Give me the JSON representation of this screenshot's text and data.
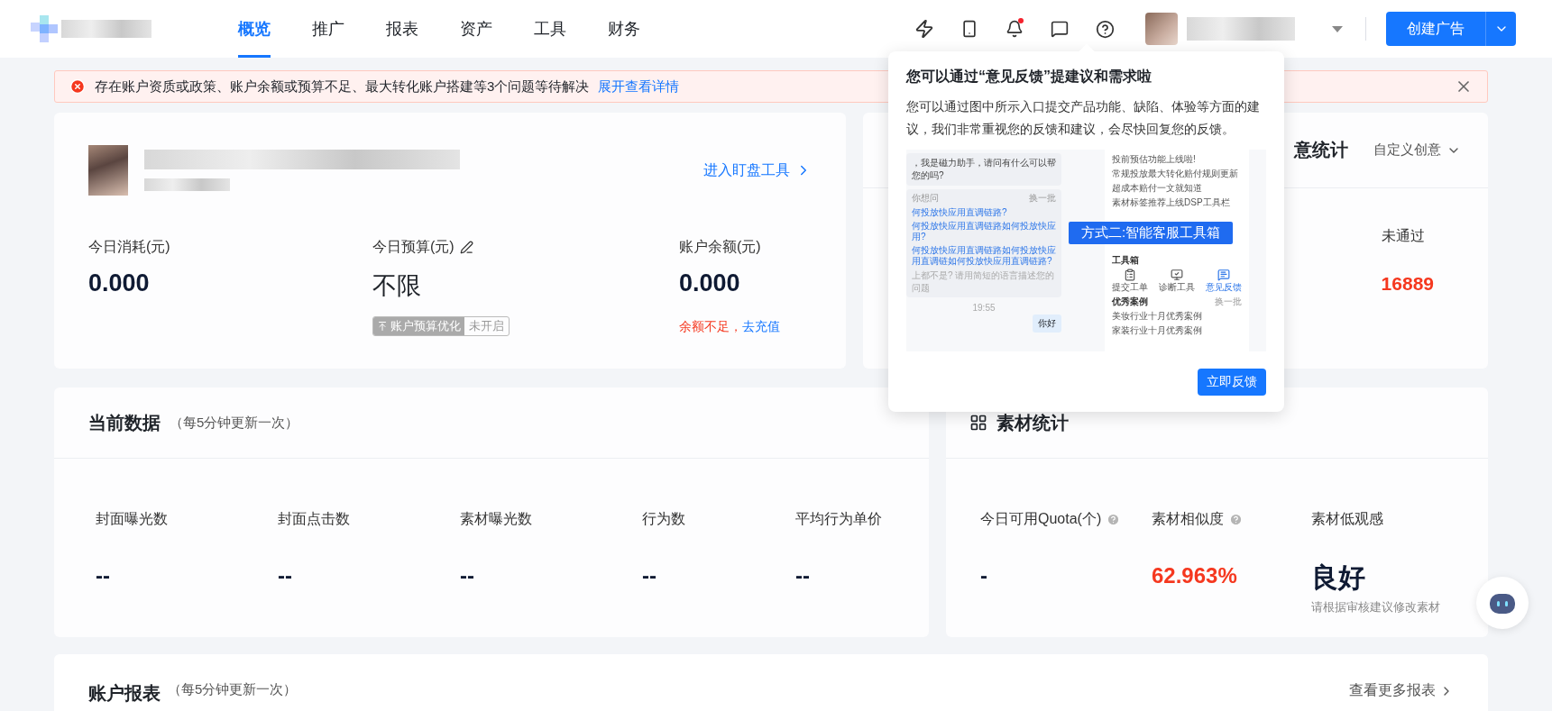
{
  "nav": {
    "tabs": [
      {
        "label": "概览",
        "selected": true
      },
      {
        "label": "推广",
        "selected": false
      },
      {
        "label": "报表",
        "selected": false
      },
      {
        "label": "资产",
        "selected": false
      },
      {
        "label": "工具",
        "selected": false
      },
      {
        "label": "财务",
        "selected": false
      }
    ],
    "notifications": {
      "unread": true
    },
    "create_button": {
      "label": "创建广告"
    }
  },
  "alert": {
    "message": "存在账户资质或政策、账户余额或预算不足、最大转化账户搭建等3个问题等待解决",
    "link": "展开查看详情"
  },
  "account_card": {
    "link": "进入盯盘工具",
    "stats": [
      {
        "kind": "plain",
        "label": "今日消耗(元)",
        "value": "0.000"
      },
      {
        "kind": "budget",
        "label": "今日预算(元)",
        "value": "不限",
        "tag": "账户预算优化",
        "tag_status": "未开启"
      },
      {
        "kind": "balance",
        "label": "账户余额(元)",
        "value": "0.000",
        "warning": "余额不足，",
        "action": "去充值"
      }
    ]
  },
  "creative_card": {
    "title": "意统计",
    "filter": "自定义创意",
    "stats": [
      {
        "label": "未通过",
        "value": "16889",
        "color": "#f5381f"
      }
    ]
  },
  "popover": {
    "title": "您可以通过“意见反馈”提建议和需求啦",
    "body": "您可以通过图中所示入口提交产品功能、缺陷、体验等方面的建议，我们非常重视您的反馈和建议，会尽快回复您的反馈。",
    "button": "立即反馈",
    "image": {
      "greeting": "，我是磁力助手，请问有什么可以帮您的吗?",
      "suggest_title": "你想问",
      "refresh": "换一批",
      "questions": [
        "何投放快应用直调链路?",
        "何投放快应用直调链路如何投放快应用?",
        "何投放快应用直调链路如何投放快应用直调链如何投放快应用直调链路?"
      ],
      "fallback": "上都不是? 请用简短的语言描述您的问题",
      "time": "19:55",
      "user_msg": "你好",
      "notices": [
        "投前预估功能上线啦!",
        "常规投放最大转化赔付规则更新",
        "超成本赔付一文就知道",
        "素材标签推荐上线DSP工具栏"
      ],
      "banner": "方式二:智能客服工具箱",
      "toolbox_title": "工具箱",
      "tools": [
        {
          "label": "提交工单",
          "highlighted": false
        },
        {
          "label": "诊断工具",
          "highlighted": false
        },
        {
          "label": "意见反馈",
          "highlighted": true
        }
      ],
      "cases_title": "优秀案例",
      "cases_refresh": "换一批",
      "cases": [
        "美妆行业十月优秀案例",
        "家装行业十月优秀案例"
      ]
    }
  },
  "current_data": {
    "title": "当前数据",
    "note": "（每5分钟更新一次）",
    "metrics": [
      {
        "label": "封面曝光数",
        "value": "--"
      },
      {
        "label": "封面点击数",
        "value": "--"
      },
      {
        "label": "素材曝光数",
        "value": "--"
      },
      {
        "label": "行为数",
        "value": "--"
      },
      {
        "label": "平均行为单价",
        "value": "--"
      }
    ]
  },
  "material_stats": {
    "title": "素材统计",
    "metrics": [
      {
        "label": "今日可用Quota(个)",
        "value": "-",
        "help": true,
        "color": "#0f1a33"
      },
      {
        "label": "素材相似度",
        "value": "62.963%",
        "help": true,
        "color": "#f5381f"
      },
      {
        "label": "素材低观感",
        "value": "良好",
        "help": false,
        "color": "#0f1a33",
        "hint": "请根据审核建议修改素材"
      }
    ]
  },
  "account_report": {
    "title": "账户报表",
    "note": "（每5分钟更新一次）",
    "link": "查看更多报表"
  }
}
